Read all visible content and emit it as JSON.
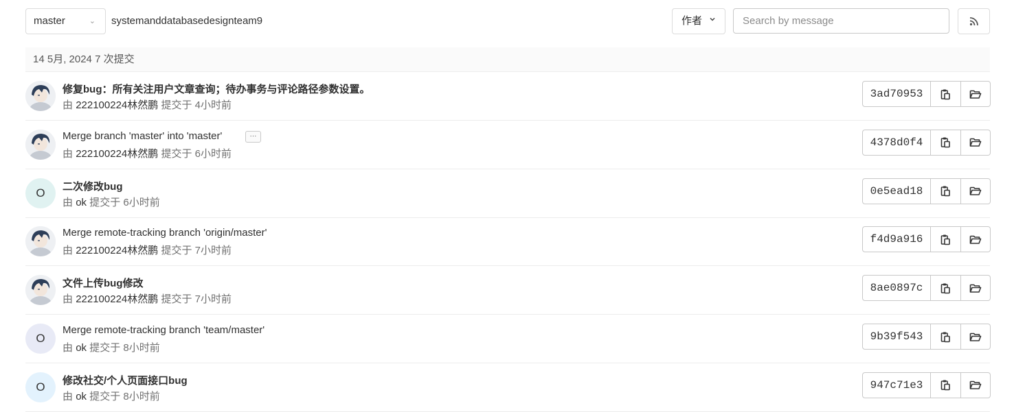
{
  "toolbar": {
    "branch": "master",
    "project_path": "systemanddatabasedesignteam9",
    "author_label": "作者",
    "search_placeholder": "Search by message"
  },
  "day_header": "14 5月, 2024 7 次提交",
  "commits": [
    {
      "title": "修复bug：所有关注用户文章查询；待办事务与评论路径参数设置。",
      "author": "222100224林然鹏",
      "committed_text": "提交于 4小时前",
      "by_prefix": "由",
      "sha": "3ad70953",
      "avatar": "image",
      "avatar_letter": ""
    },
    {
      "title": "Merge branch 'master' into 'master'",
      "author": "222100224林然鹏",
      "committed_text": "提交于 6小时前",
      "by_prefix": "由",
      "sha": "4378d0f4",
      "avatar": "image",
      "avatar_letter": "",
      "ellipsis": "···"
    },
    {
      "title": "二次修改bug",
      "author": "ok",
      "committed_text": "提交于 6小时前",
      "by_prefix": "由",
      "sha": "0e5ead18",
      "avatar": "letter",
      "avatar_letter": "O",
      "avatar_color": "#e0f2f1"
    },
    {
      "title": "Merge remote-tracking branch 'origin/master'",
      "author": "222100224林然鹏",
      "committed_text": "提交于 7小时前",
      "by_prefix": "由",
      "sha": "f4d9a916",
      "avatar": "image",
      "avatar_letter": ""
    },
    {
      "title": "文件上传bug修改",
      "author": "222100224林然鹏",
      "committed_text": "提交于 7小时前",
      "by_prefix": "由",
      "sha": "8ae0897c",
      "avatar": "image",
      "avatar_letter": ""
    },
    {
      "title": "Merge remote-tracking branch 'team/master'",
      "author": "ok",
      "committed_text": "提交于 8小时前",
      "by_prefix": "由",
      "sha": "9b39f543",
      "avatar": "letter",
      "avatar_letter": "O",
      "avatar_color": "#e8eaf6"
    },
    {
      "title": "修改社交/个人页面接口bug",
      "author": "ok",
      "committed_text": "提交于 8小时前",
      "by_prefix": "由",
      "sha": "947c71e3",
      "avatar": "letter",
      "avatar_letter": "O",
      "avatar_color": "#e3f2fd"
    }
  ],
  "icons": {
    "rss": "rss-icon",
    "copy": "copy-icon",
    "browse": "folder-open-icon",
    "dropdown": "chevron-down-icon"
  }
}
